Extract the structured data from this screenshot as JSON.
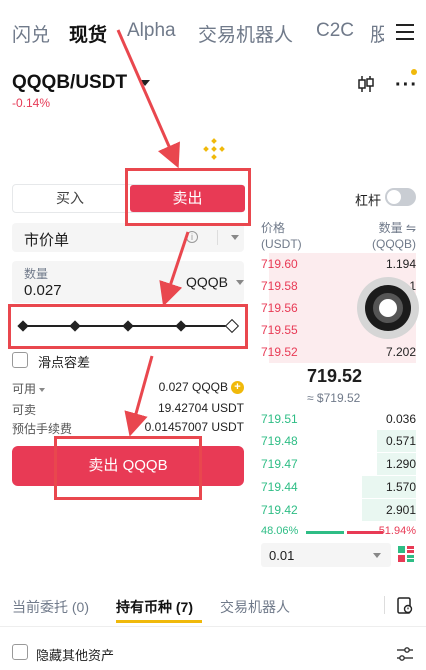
{
  "nav": {
    "tabs": [
      {
        "label": "闪兑",
        "active": false
      },
      {
        "label": "现货",
        "active": true
      },
      {
        "label": "Alpha",
        "active": false
      },
      {
        "label": "交易机器人",
        "active": false
      },
      {
        "label": "C2C",
        "active": false
      },
      {
        "label": "股",
        "active": false
      }
    ],
    "menu_icon": "hamburger-icon"
  },
  "pair": {
    "symbol": "QQQB/USDT",
    "change": "-0.14%"
  },
  "side_toggle": {
    "buy_label": "买入",
    "sell_label": "卖出",
    "selected": "卖出"
  },
  "leverage": {
    "label": "杠杆",
    "enabled": false
  },
  "order_type": {
    "value": "市价单"
  },
  "quantity": {
    "label": "数量",
    "value": "0.027",
    "unit": "QQQB"
  },
  "slider": {
    "level": 1.0
  },
  "slippage": {
    "label": "滑点容差",
    "checked": false
  },
  "info": {
    "available_label": "可用",
    "available_value": "0.027 QQQB",
    "sellable_label": "可卖",
    "sellable_value": "19.42704 USDT",
    "fee_label": "预估手续费",
    "fee_value": "0.01457007 USDT"
  },
  "sell_button": {
    "label": "卖出 QQQB"
  },
  "orderbook": {
    "price_header": "价格",
    "price_unit": "(USDT)",
    "qty_header": "数量 ⇋",
    "qty_unit": "(QQQB)",
    "asks": [
      {
        "price": "719.60",
        "qty": "1.194",
        "depth": 0.95
      },
      {
        "price": "719.58",
        "qty": "1",
        "depth": 0.95
      },
      {
        "price": "719.56",
        "qty": "",
        "depth": 0.95
      },
      {
        "price": "719.55",
        "qty": "",
        "depth": 0.95
      },
      {
        "price": "719.52",
        "qty": "7.202",
        "depth": 0.95
      }
    ],
    "last_price": "719.52",
    "last_price_usd": "≈ $719.52",
    "bids": [
      {
        "price": "719.51",
        "qty": "0.036",
        "depth": 0.0
      },
      {
        "price": "719.48",
        "qty": "0.571",
        "depth": 0.25
      },
      {
        "price": "719.47",
        "qty": "1.290",
        "depth": 0.25
      },
      {
        "price": "719.44",
        "qty": "1.570",
        "depth": 0.35
      },
      {
        "price": "719.42",
        "qty": "2.901",
        "depth": 0.35
      }
    ],
    "buy_ratio": "48.06%",
    "sell_ratio": "51.94%",
    "precision": "0.01"
  },
  "bottom_tabs": [
    {
      "label": "当前委托 (0)",
      "active": false
    },
    {
      "label": "持有币种 (7)",
      "active": true
    },
    {
      "label": "交易机器人",
      "active": false
    }
  ],
  "hide_assets": {
    "label": "隐藏其他资产",
    "checked": false
  },
  "colors": {
    "sell": "#e83a55",
    "buy": "#2ebd85",
    "accent": "#f0b90b",
    "annotation": "#e9474e"
  }
}
